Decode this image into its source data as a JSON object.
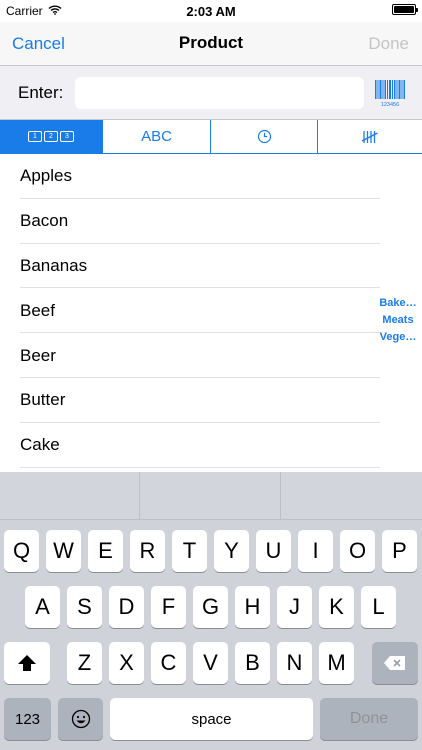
{
  "status_bar": {
    "carrier": "Carrier",
    "time": "2:03 AM",
    "battery_level": 1.0
  },
  "nav": {
    "cancel": "Cancel",
    "title": "Product",
    "done": "Done"
  },
  "entry": {
    "label": "Enter:",
    "value": "",
    "barcode_caption": "123456"
  },
  "segments": [
    {
      "label": "123",
      "digits": [
        "1",
        "2",
        "3"
      ],
      "icon": "number-boxes-icon",
      "selected": true
    },
    {
      "label": "ABC",
      "selected": false
    },
    {
      "label": "",
      "icon": "clock-icon",
      "selected": false
    },
    {
      "label": "",
      "icon": "tally-icon",
      "selected": false
    }
  ],
  "items": [
    "Apples",
    "Bacon",
    "Bananas",
    "Beef",
    "Beer",
    "Butter",
    "Cake"
  ],
  "section_index": [
    "Bake…",
    "Meats",
    "Vege…"
  ],
  "keyboard": {
    "row1": [
      "Q",
      "W",
      "E",
      "R",
      "T",
      "Y",
      "U",
      "I",
      "O",
      "P"
    ],
    "row2": [
      "A",
      "S",
      "D",
      "F",
      "G",
      "H",
      "J",
      "K",
      "L"
    ],
    "row3": [
      "Z",
      "X",
      "C",
      "V",
      "B",
      "N",
      "M"
    ],
    "numbers_key": "123",
    "space_key": "space",
    "done_key": "Done"
  },
  "colors": {
    "accent": "#1a7ce8",
    "disabled": "#c4c4c6",
    "keyboard_bg": "#cfd3d9"
  }
}
